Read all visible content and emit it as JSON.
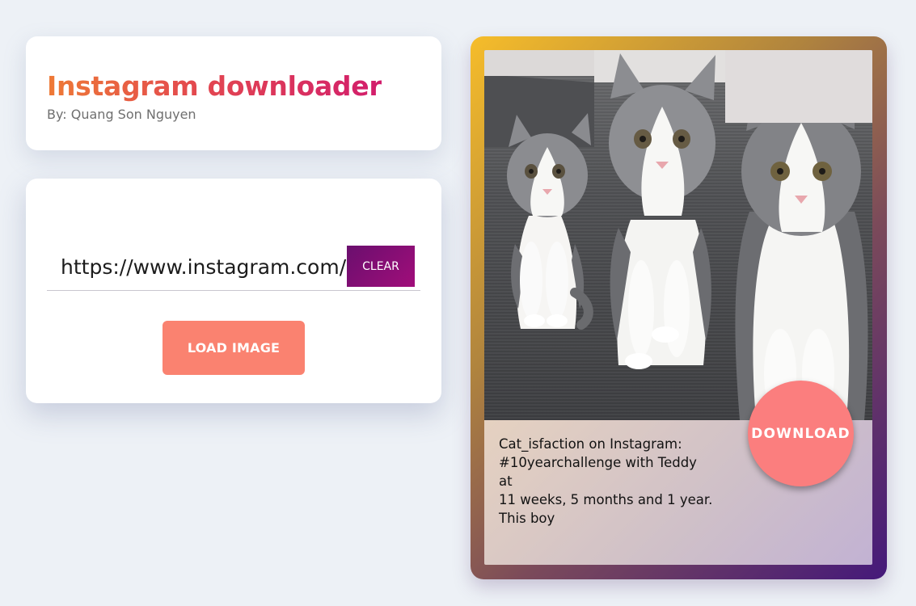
{
  "header": {
    "title": "Instagram downloader",
    "author": "By: Quang Son Nguyen"
  },
  "form": {
    "url_value": "https://www.instagram.com/p/",
    "clear_label": "CLEAR",
    "load_label": "LOAD IMAGE"
  },
  "result": {
    "caption_lines": [
      "Cat_isfaction on Instagram:",
      "#10yearchallenge with Teddy at",
      "11 weeks, 5 months and 1 year.",
      "This boy"
    ],
    "download_label": "DOWNLOAD"
  },
  "colors": {
    "accent_orange": "#ee7a36",
    "accent_pink": "#d21d6c",
    "clear_button": "#6a0f6e",
    "load_button": "#fa8270",
    "download_button": "#fb7e7e"
  }
}
